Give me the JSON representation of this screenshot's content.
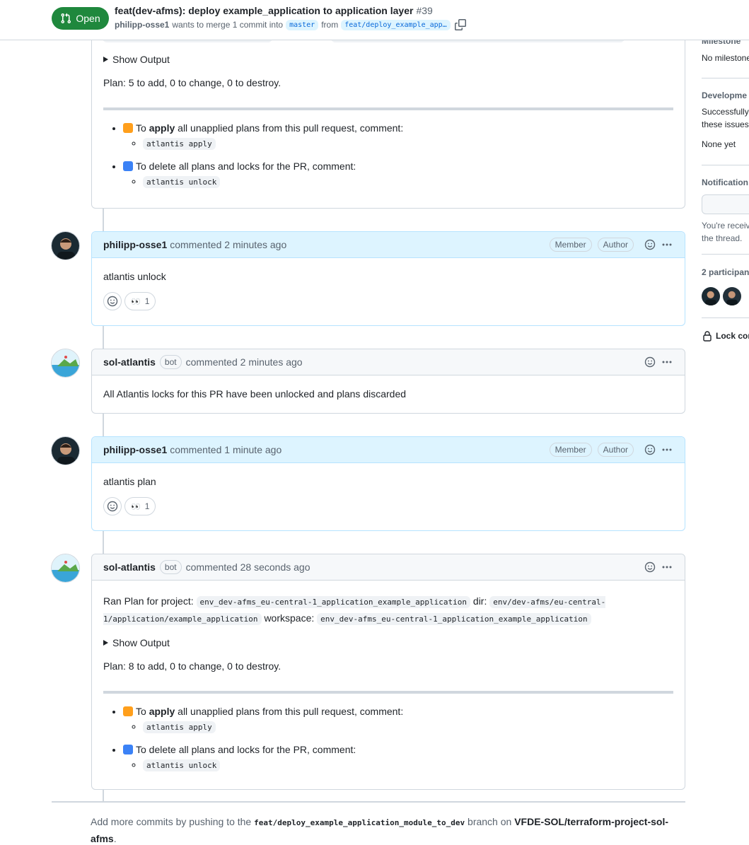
{
  "header": {
    "state_label": "Open",
    "title": "feat(dev-afms): deploy example_application to application layer",
    "number": "#39",
    "author": "philipp-osse1",
    "merge_text": "wants to merge 1 commit into",
    "base_branch": "master",
    "from_text": "from",
    "head_branch": "feat/deploy_example_app…"
  },
  "top_partial": {
    "show_output": "Show Output",
    "plan_summary": "Plan: 5 to add, 0 to change, 0 to destroy.",
    "apply_pre": "To",
    "apply_bold": "apply",
    "apply_post": "all unapplied plans from this pull request, comment:",
    "apply_cmd": "atlantis apply",
    "unlock_text": "To delete all plans and locks for the PR, comment:",
    "unlock_cmd": "atlantis unlock"
  },
  "comments": [
    {
      "author": "philipp-osse1",
      "action": "commented",
      "time": "2 minutes ago",
      "badges": [
        "Member",
        "Author"
      ],
      "body": "atlantis unlock",
      "reaction_emoji": "👀",
      "reaction_count": "1"
    },
    {
      "author": "sol-atlantis",
      "bot_label": "bot",
      "action": "commented",
      "time": "2 minutes ago",
      "body": "All Atlantis locks for this PR have been unlocked and plans discarded"
    },
    {
      "author": "philipp-osse1",
      "action": "commented",
      "time": "1 minute ago",
      "badges": [
        "Member",
        "Author"
      ],
      "body": "atlantis plan",
      "reaction_emoji": "👀",
      "reaction_count": "1"
    },
    {
      "author": "sol-atlantis",
      "bot_label": "bot",
      "action": "commented",
      "time": "28 seconds ago",
      "ran_plan_text": "Ran Plan for project:",
      "project": "env_dev-afms_eu-central-1_application_example_application",
      "dir_text": "dir:",
      "dir": "env/dev-afms/eu-central-1/application/example_application",
      "workspace_text": "workspace:",
      "workspace": "env_dev-afms_eu-central-1_application_example_application",
      "show_output": "Show Output",
      "plan_summary": "Plan: 8 to add, 0 to change, 0 to destroy.",
      "apply_pre": "To",
      "apply_bold": "apply",
      "apply_post": "all unapplied plans from this pull request, comment:",
      "apply_cmd": "atlantis apply",
      "unlock_text": "To delete all plans and locks for the PR, comment:",
      "unlock_cmd": "atlantis unlock"
    }
  ],
  "footer": {
    "pre": "Add more commits by pushing to the",
    "branch": "feat/deploy_example_application_module_to_dev",
    "mid": "branch on",
    "repo": "VFDE-SOL/terraform-project-sol-afms",
    "end": "."
  },
  "sidebar": {
    "milestone_title": "Milestone",
    "milestone_value": "No milestone",
    "development_title": "Developme",
    "development_text_1": "Successfully",
    "development_text_2": "these issues",
    "development_none": "None yet",
    "notifications_title": "Notification",
    "notifications_text_1": "You're receiv",
    "notifications_text_2": "the thread.",
    "participants_title": "2 participan",
    "lock_label": "Lock cor"
  },
  "colors": {
    "open_green": "#1f883d",
    "own_comment_bg": "#ddf4ff",
    "link_blue": "#0969da"
  }
}
